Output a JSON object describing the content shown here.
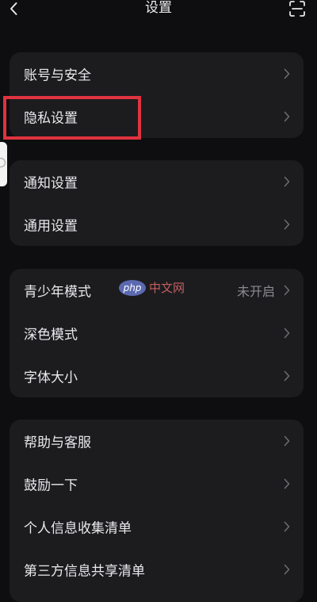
{
  "header": {
    "title": "设置"
  },
  "groups": [
    {
      "items": [
        {
          "label": "账号与安全"
        },
        {
          "label": "隐私设置"
        }
      ]
    },
    {
      "items": [
        {
          "label": "通知设置"
        },
        {
          "label": "通用设置"
        }
      ]
    },
    {
      "items": [
        {
          "label": "青少年模式",
          "value": "未开启"
        },
        {
          "label": "深色模式"
        },
        {
          "label": "字体大小"
        }
      ]
    },
    {
      "items": [
        {
          "label": "帮助与客服"
        },
        {
          "label": "鼓励一下"
        },
        {
          "label": "个人信息收集清单"
        },
        {
          "label": "第三方信息共享清单"
        }
      ]
    }
  ],
  "watermark": {
    "badge": "php",
    "text": "中文网"
  },
  "colors": {
    "background": "#0e0e10",
    "card": "#1c1c1f",
    "highlight": "#e0323f"
  },
  "icons": {
    "back": "chevron-left-icon",
    "scan": "scan-icon",
    "row_arrow": "chevron-right-icon"
  }
}
